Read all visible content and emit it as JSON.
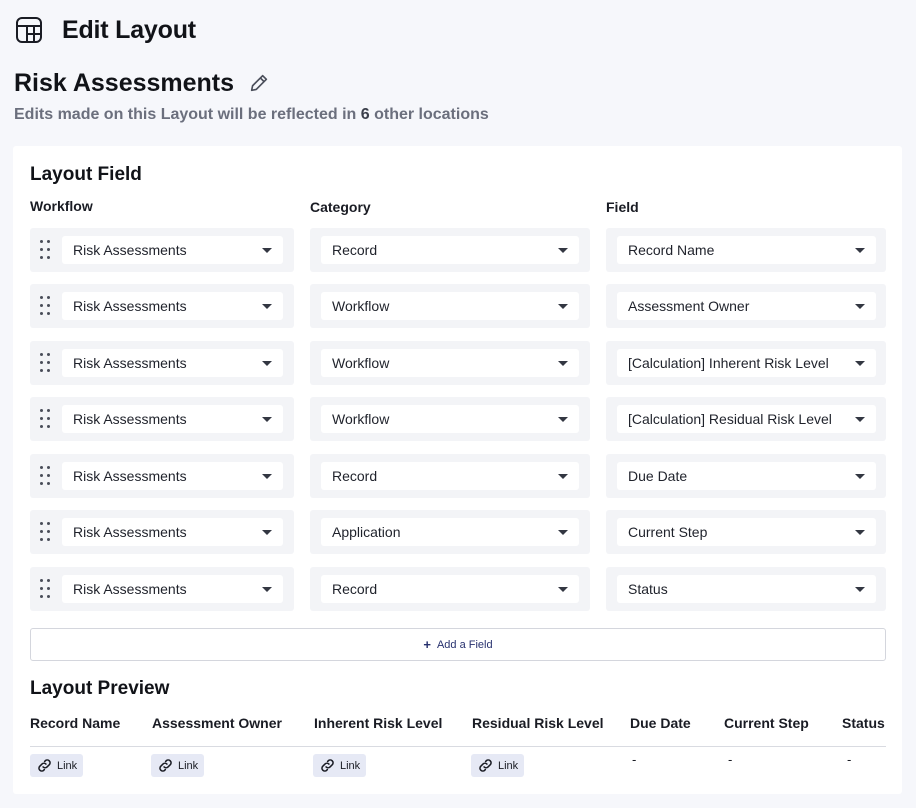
{
  "header": {
    "title": "Edit Layout",
    "icon": "layout-grid-icon"
  },
  "layout": {
    "name": "Risk Assessments",
    "notice_prefix": "Edits made on this Layout will be reflected in ",
    "notice_count": "6",
    "notice_suffix": " other locations"
  },
  "layout_field": {
    "title": "Layout Field",
    "columns": {
      "workflow": "Workflow",
      "category": "Category",
      "field": "Field"
    },
    "rows": [
      {
        "workflow": "Risk Assessments",
        "category": "Record",
        "field": "Record Name"
      },
      {
        "workflow": "Risk Assessments",
        "category": "Workflow",
        "field": "Assessment Owner"
      },
      {
        "workflow": "Risk Assessments",
        "category": "Workflow",
        "field": "[Calculation] Inherent Risk Level"
      },
      {
        "workflow": "Risk Assessments",
        "category": "Workflow",
        "field": "[Calculation] Residual Risk Level"
      },
      {
        "workflow": "Risk Assessments",
        "category": "Record",
        "field": "Due Date"
      },
      {
        "workflow": "Risk Assessments",
        "category": "Application",
        "field": "Current Step"
      },
      {
        "workflow": "Risk Assessments",
        "category": "Record",
        "field": "Status"
      }
    ],
    "add_label": "Add a Field"
  },
  "preview": {
    "title": "Layout Preview",
    "headers": [
      "Record Name",
      "Assessment Owner",
      "Inherent Risk Level",
      "Residual Risk Level",
      "Due Date",
      "Current Step",
      "Status"
    ],
    "cells": [
      {
        "type": "link",
        "label": "Link"
      },
      {
        "type": "link",
        "label": "Link"
      },
      {
        "type": "link",
        "label": "Link"
      },
      {
        "type": "link",
        "label": "Link"
      },
      {
        "type": "text",
        "label": "-"
      },
      {
        "type": "text",
        "label": "-"
      },
      {
        "type": "text",
        "label": "-"
      }
    ]
  },
  "colors": {
    "accent": "#27316e",
    "chip_bg": "#e6e9f5",
    "row_bg": "#f3f4f7",
    "page_bg": "#f6f7fb"
  }
}
